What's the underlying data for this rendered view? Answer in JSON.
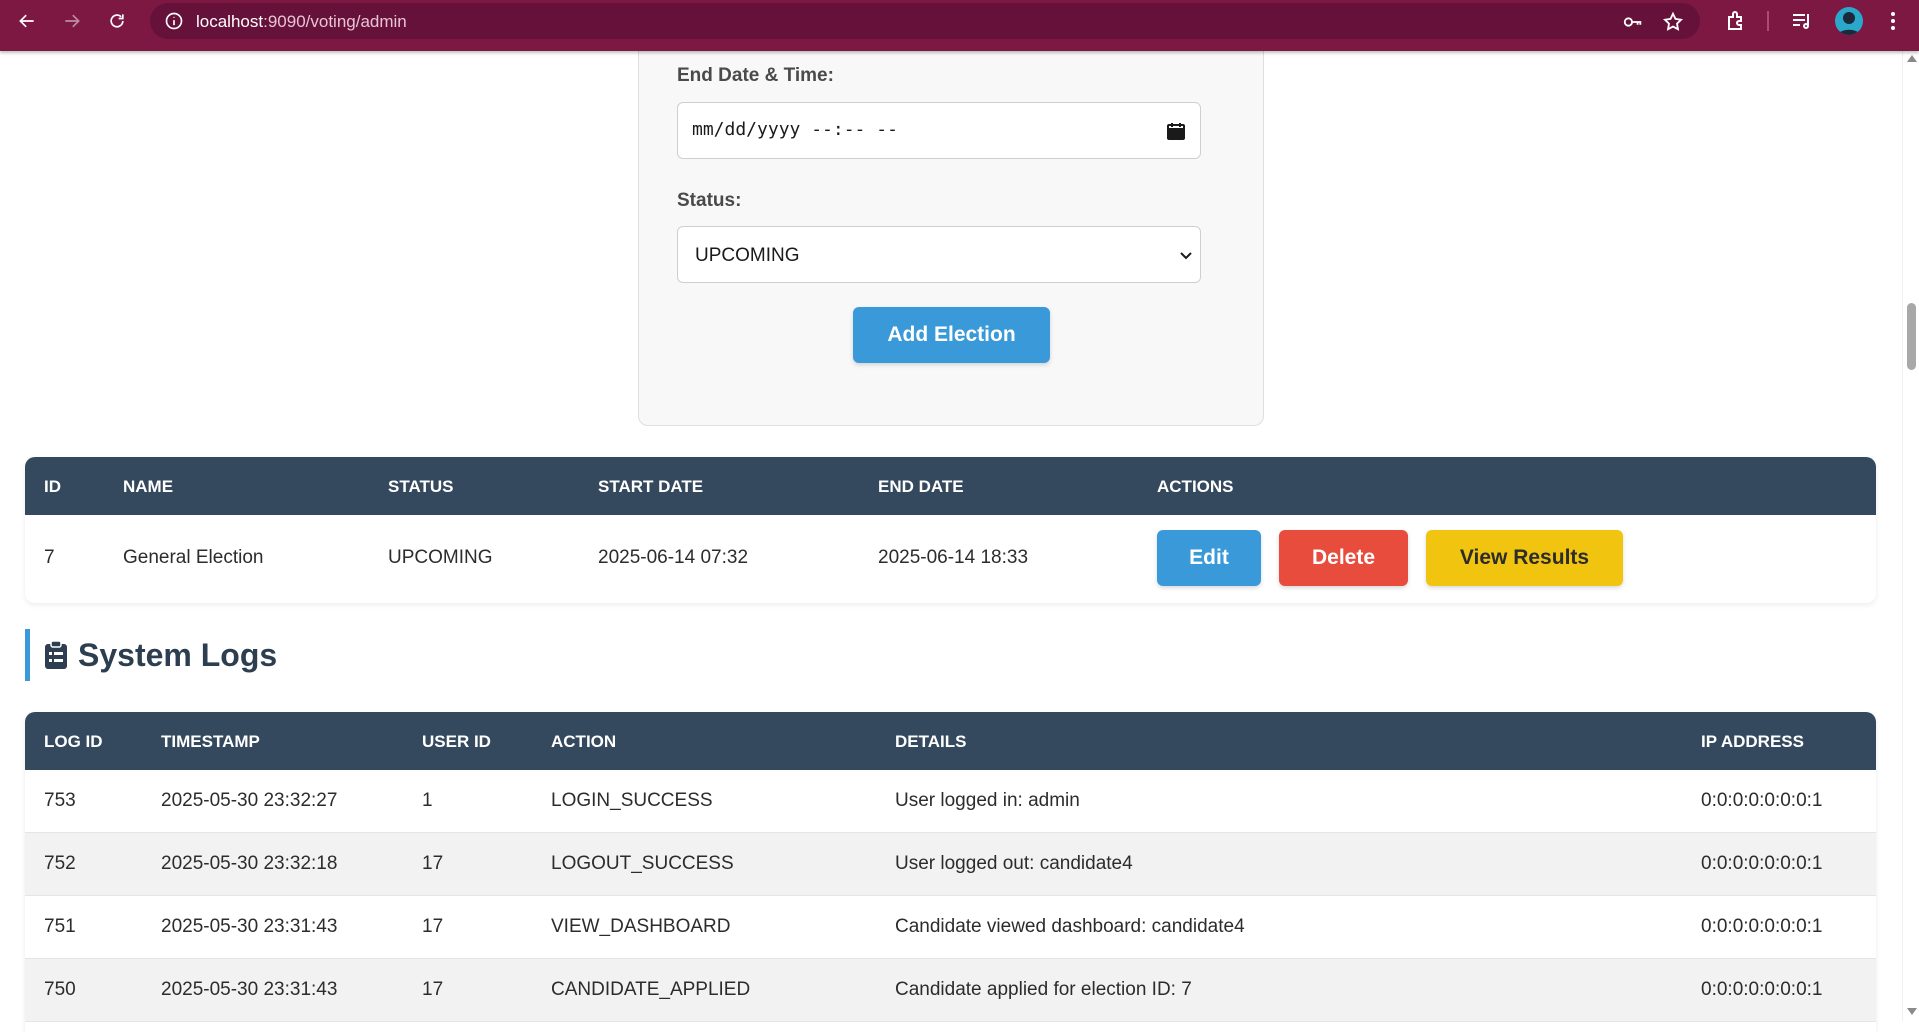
{
  "browser": {
    "url_host": "localhost",
    "url_path": ":9090/voting/admin"
  },
  "form": {
    "end_label": "End Date & Time:",
    "end_value": "mm/dd/yyyy --:-- --",
    "status_label": "Status:",
    "status_value": "UPCOMING",
    "add_button": "Add Election"
  },
  "elections_table": {
    "headers": [
      "ID",
      "NAME",
      "STATUS",
      "START DATE",
      "END DATE",
      "ACTIONS"
    ],
    "rows": [
      {
        "id": "7",
        "name": "General Election",
        "status": "UPCOMING",
        "start": "2025-06-14 07:32",
        "end": "2025-06-14 18:33"
      }
    ],
    "actions": {
      "edit": "Edit",
      "delete": "Delete",
      "view": "View Results"
    }
  },
  "logs_section": {
    "title": "System Logs"
  },
  "logs_table": {
    "headers": [
      "LOG ID",
      "TIMESTAMP",
      "USER ID",
      "ACTION",
      "DETAILS",
      "IP ADDRESS"
    ],
    "rows": [
      {
        "log_id": "753",
        "timestamp": "2025-05-30 23:32:27",
        "user_id": "1",
        "action": "LOGIN_SUCCESS",
        "details": "User logged in: admin",
        "ip": "0:0:0:0:0:0:0:1"
      },
      {
        "log_id": "752",
        "timestamp": "2025-05-30 23:32:18",
        "user_id": "17",
        "action": "LOGOUT_SUCCESS",
        "details": "User logged out: candidate4",
        "ip": "0:0:0:0:0:0:0:1"
      },
      {
        "log_id": "751",
        "timestamp": "2025-05-30 23:31:43",
        "user_id": "17",
        "action": "VIEW_DASHBOARD",
        "details": "Candidate viewed dashboard: candidate4",
        "ip": "0:0:0:0:0:0:0:1"
      },
      {
        "log_id": "750",
        "timestamp": "2025-05-30 23:31:43",
        "user_id": "17",
        "action": "CANDIDATE_APPLIED",
        "details": "Candidate applied for election ID: 7",
        "ip": "0:0:0:0:0:0:0:1"
      }
    ]
  },
  "colors": {
    "browser_bar": "#7d1843",
    "table_header": "#34495e",
    "edit": "#3a9ad9",
    "delete": "#e74c3c",
    "view_results": "#f1c40f"
  }
}
